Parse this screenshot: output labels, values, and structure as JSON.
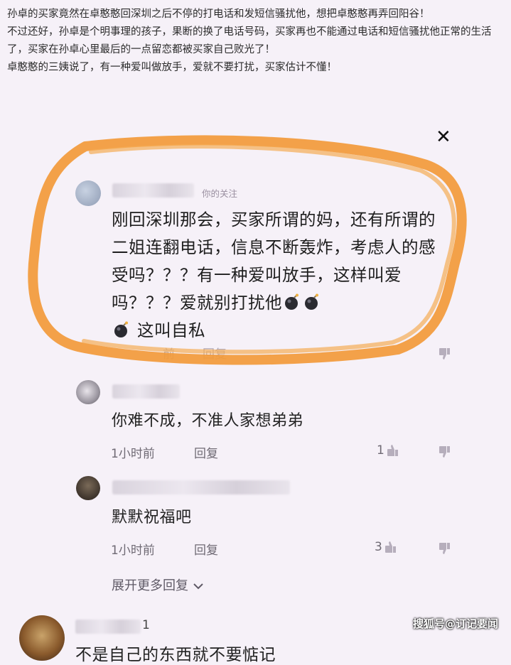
{
  "article": {
    "paragraphs": [
      "孙卓的买家竟然在卓憨憨回深圳之后不停的打电话和发短信骚扰他，想把卓憨憨再弄回阳谷！",
      "不过还好，孙卓是个明事理的孩子，果断的换了电话号码，买家再也不能通过电话和短信骚扰他正常的生活了，买家在孙卓心里最后的一点留恋都被买家自己败光了！",
      "卓憨憨的三姨说了，有一种爱叫做放手，爱就不要打扰，买家估计不懂！"
    ]
  },
  "close_icon": "✕",
  "main_comment": {
    "follow_tag": "你的关注",
    "text_segments": [
      "刚回深圳那会，买家所谓的妈，还有所谓的二姐连翻电话，信息不断轰炸，考虑人的感受吗？？？有一种爱叫放手，这样叫爱吗？？？爱就别打扰他",
      "这叫自私"
    ],
    "emoji": "bomb-icon",
    "reply_label": "回复",
    "partial_time": "前"
  },
  "replies": [
    {
      "text": "你难不成，不准人家想弟弟",
      "time": "1小时前",
      "reply_label": "回复",
      "likes": "1"
    },
    {
      "text": "默默祝福吧",
      "time": "1小时前",
      "reply_label": "回复",
      "likes": "3"
    }
  ],
  "expand_label": "展开更多回复",
  "bottom_comment": {
    "name_suffix": "1",
    "text": "不是自己的东西就不要惦记"
  },
  "watermark": "搜狐号@订记要闻",
  "colors": {
    "highlight": "#f29a3a",
    "background": "#f6f1f8"
  }
}
